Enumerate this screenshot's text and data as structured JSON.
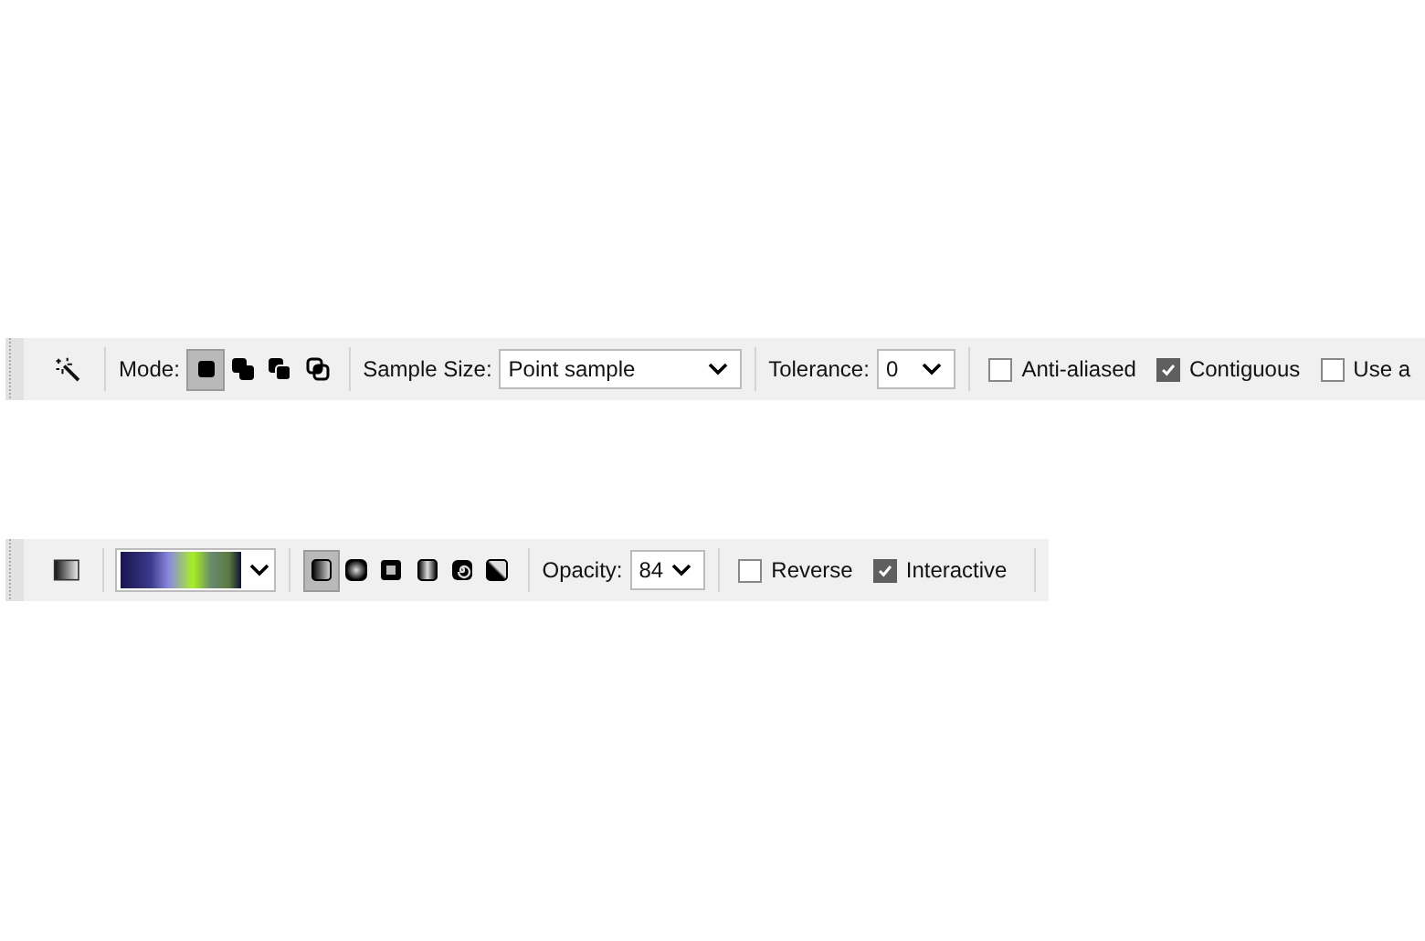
{
  "magic_wand_toolbar": {
    "mode_label": "Mode:",
    "modes": [
      {
        "kind": "replace",
        "selected": true
      },
      {
        "kind": "union",
        "selected": false
      },
      {
        "kind": "exclude",
        "selected": false
      },
      {
        "kind": "intersect",
        "selected": false
      }
    ],
    "sample_size_label": "Sample Size:",
    "sample_size": "Point sample",
    "tolerance_label": "Tolerance:",
    "tolerance": "0",
    "checkboxes": [
      {
        "label": "Anti-aliased",
        "checked": false
      },
      {
        "label": "Contiguous",
        "checked": true
      },
      {
        "label": "Use a",
        "checked": false
      }
    ]
  },
  "gradient_toolbar": {
    "gradient_types": [
      {
        "kind": "linear",
        "selected": true
      },
      {
        "kind": "radial",
        "selected": false
      },
      {
        "kind": "square",
        "selected": false
      },
      {
        "kind": "reflected",
        "selected": false
      },
      {
        "kind": "spiral",
        "selected": false
      },
      {
        "kind": "diagonal",
        "selected": false
      }
    ],
    "opacity_label": "Opacity:",
    "opacity": "84",
    "checkboxes": [
      {
        "label": "Reverse",
        "checked": false
      },
      {
        "label": "Interactive",
        "checked": true
      }
    ]
  }
}
